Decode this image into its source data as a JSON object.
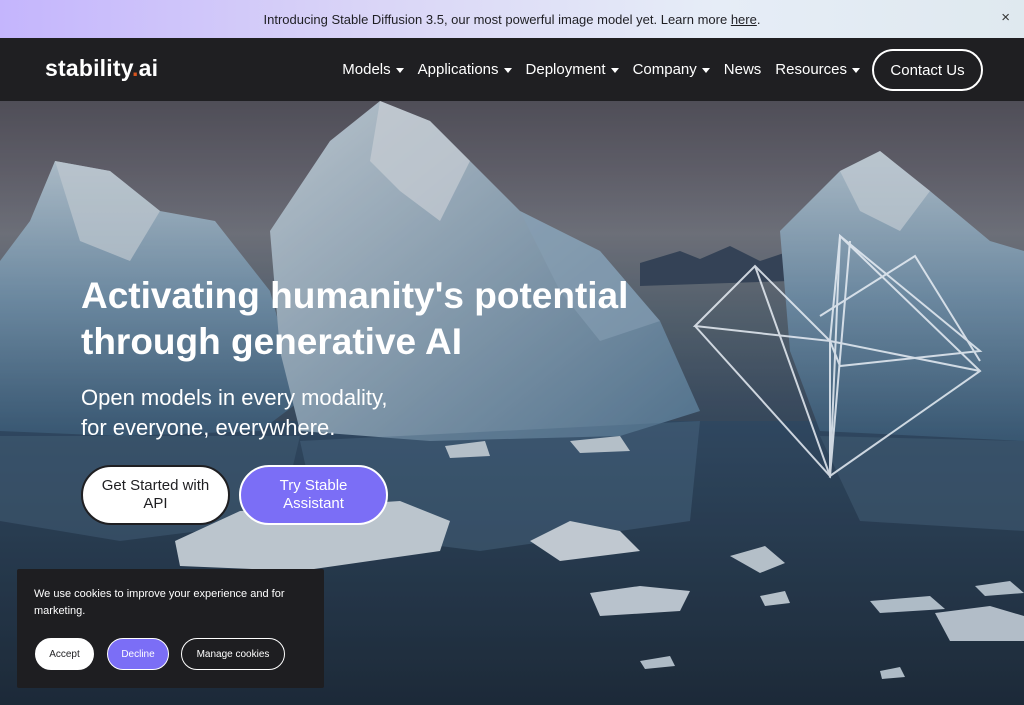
{
  "announcement": {
    "text": "Introducing Stable Diffusion 3.5, our most powerful image model yet. Learn more ",
    "link_text": "here",
    "suffix": ".",
    "close_glyph": "×"
  },
  "brand": {
    "logo_main": "stability",
    "logo_dot": ".",
    "logo_suffix": "ai",
    "dot_color": "#d9541e"
  },
  "nav": {
    "items": [
      {
        "label": "Models",
        "has_dropdown": true
      },
      {
        "label": "Applications",
        "has_dropdown": true
      },
      {
        "label": "Deployment",
        "has_dropdown": true
      },
      {
        "label": "Company",
        "has_dropdown": true
      },
      {
        "label": "News",
        "has_dropdown": false
      },
      {
        "label": "Resources",
        "has_dropdown": true
      }
    ],
    "contact_label": "Contact Us"
  },
  "hero": {
    "headline_line1": "Activating humanity's potential",
    "headline_line2": "through generative AI",
    "sub_line1": "Open models in every modality,",
    "sub_line2": "for everyone, everywhere.",
    "cta_primary": "Get Started with API",
    "cta_secondary": "Try Stable Assistant",
    "accent_color": "#7b6ef6"
  },
  "cookie": {
    "text": "We use cookies to improve your experience and for marketing.",
    "accept_label": "Accept",
    "decline_label": "Decline",
    "manage_label": "Manage cookies"
  }
}
